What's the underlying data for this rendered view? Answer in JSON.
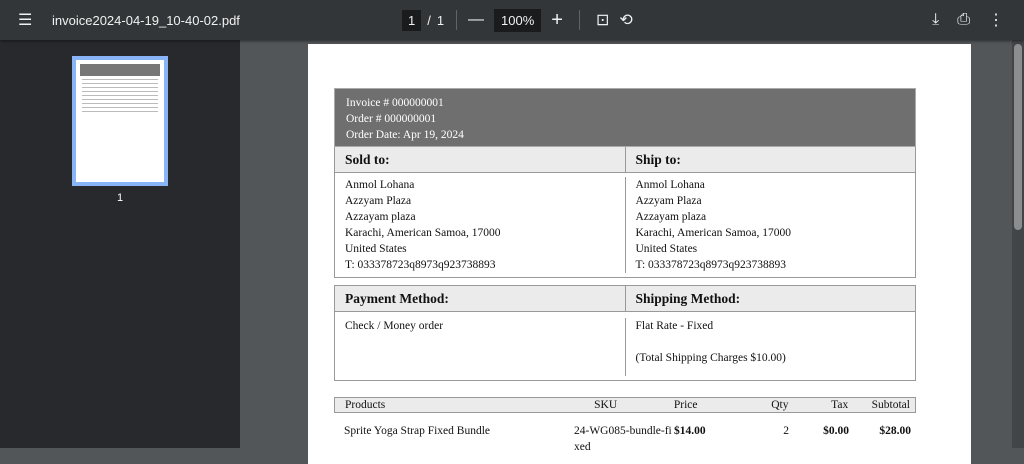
{
  "toolbar": {
    "title": "invoice2024-04-19_10-40-02.pdf",
    "page_current": "1",
    "page_sep": "/",
    "page_total": "1",
    "zoom": "100%"
  },
  "sidebar": {
    "thumb_label": "1"
  },
  "invoice": {
    "invoice_no": "Invoice # 000000001",
    "order_no": "Order # 000000001",
    "order_date": "Order Date: Apr 19, 2024",
    "sold_to_label": "Sold to:",
    "ship_to_label": "Ship to:",
    "sold_to": [
      "Anmol Lohana",
      "Azzyam Plaza",
      "Azzayam plaza",
      "Karachi, American Samoa, 17000",
      "United States",
      "T: 033378723q8973q923738893"
    ],
    "ship_to": [
      "Anmol Lohana",
      "Azzyam Plaza",
      "Azzayam plaza",
      "Karachi, American Samoa, 17000",
      "United States",
      "T: 033378723q8973q923738893"
    ],
    "payment_label": "Payment Method:",
    "shipping_label": "Shipping Method:",
    "payment": "Check / Money order",
    "shipping": "Flat Rate - Fixed",
    "shipping_charges": "(Total Shipping Charges $10.00)",
    "columns": [
      "Products",
      "SKU",
      "Price",
      "Qty",
      "Tax",
      "Subtotal"
    ],
    "items": [
      {
        "product": "Sprite Yoga Strap Fixed Bundle",
        "sku": "24-WG085-bundle-fixed",
        "price": "$14.00",
        "qty": "2",
        "tax": "$0.00",
        "subtotal": "$28.00"
      }
    ]
  }
}
